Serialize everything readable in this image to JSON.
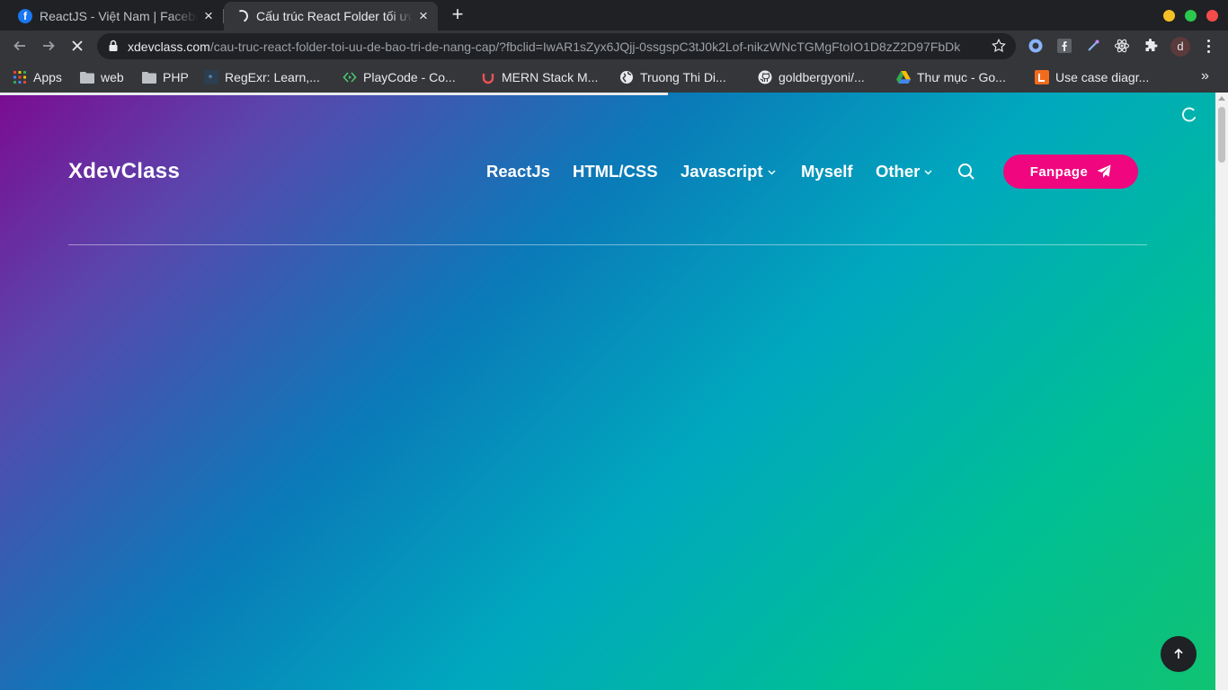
{
  "browser": {
    "tabs": [
      {
        "title": "ReactJS - Việt Nam | Facebook",
        "icon": "facebook-icon",
        "active": false
      },
      {
        "title": "Cấu trúc React Folder tối ưu",
        "icon": "loading-spinner-icon",
        "active": true
      }
    ],
    "address": {
      "host": "xdevclass.com",
      "path": "/cau-truc-react-folder-toi-uu-de-bao-tri-de-nang-cap/?fbclid=IwAR1sZyx6JQjj-0ssgspC3tJ0k2Lof-nikzWNcTGMgFtoIO1D8zZ2D97FbDk"
    },
    "profile_initial": "d",
    "bookmarks": [
      {
        "label": "Apps",
        "icon": "apps-grid-icon"
      },
      {
        "label": "web",
        "icon": "folder-icon"
      },
      {
        "label": "PHP",
        "icon": "folder-icon"
      },
      {
        "label": "RegExr: Learn,...",
        "icon": "regexr-icon"
      },
      {
        "label": "PlayCode - Co...",
        "icon": "playcode-icon"
      },
      {
        "label": "MERN Stack M...",
        "icon": "udemy-icon"
      },
      {
        "label": "Truong Thi Di...",
        "icon": "globe-icon"
      },
      {
        "label": "goldbergyoni/...",
        "icon": "github-icon"
      },
      {
        "label": "Thư mục - Go...",
        "icon": "google-drive-icon"
      },
      {
        "label": "Use case diagr...",
        "icon": "usecase-icon"
      }
    ]
  },
  "site": {
    "logo": "XdevClass",
    "nav": [
      {
        "label": "ReactJs",
        "has_dropdown": false
      },
      {
        "label": "HTML/CSS",
        "has_dropdown": false
      },
      {
        "label": "Javascript",
        "has_dropdown": true
      },
      {
        "label": "Myself",
        "has_dropdown": false
      },
      {
        "label": "Other",
        "has_dropdown": true
      }
    ],
    "cta_label": "Fanpage",
    "colors": {
      "cta": "#f0067e",
      "gradient_start": "#7b0c92",
      "gradient_mid": "#0a7ab8",
      "gradient_end": "#10c272"
    }
  }
}
